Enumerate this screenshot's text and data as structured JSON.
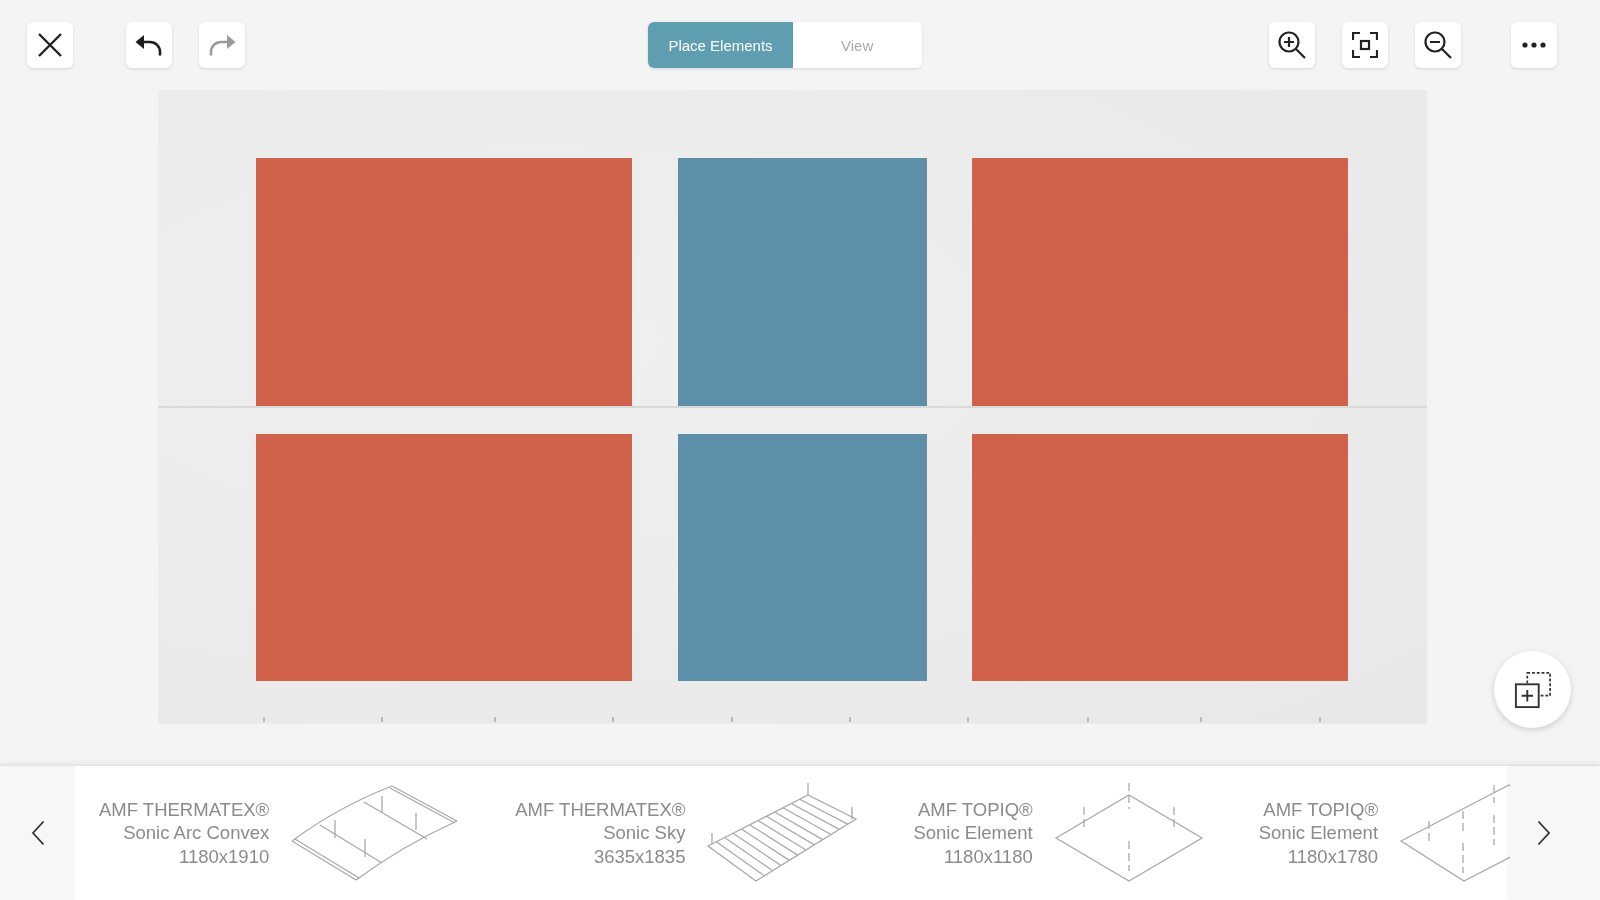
{
  "toolbar": {
    "history": [
      {
        "kind": "undo",
        "disabled": false
      },
      {
        "kind": "redo",
        "disabled": true
      }
    ],
    "mode_tabs": [
      {
        "label": "Place Elements",
        "selected": true
      },
      {
        "label": "View",
        "selected": false
      }
    ]
  },
  "canvas": {
    "panels": [
      {
        "color": "#d0624b"
      },
      {
        "color": "#5e8fa8"
      },
      {
        "color": "#d0624b"
      },
      {
        "color": "#d0624b"
      },
      {
        "color": "#5e8fa8"
      },
      {
        "color": "#d0624b"
      }
    ]
  },
  "product_strip": {
    "items": [
      {
        "kind": "arc",
        "brand": "AMF THERMATEX®",
        "name": "Sonic Arc Convex",
        "size": "1180x1910"
      },
      {
        "kind": "slats",
        "brand": "AMF THERMATEX®",
        "name": "Sonic Sky",
        "size": "3635x1835"
      },
      {
        "kind": "square",
        "brand": "AMF TOPIQ®",
        "name": "Sonic Element",
        "size": "1180x1180"
      },
      {
        "kind": "rect",
        "brand": "AMF TOPIQ®",
        "name": "Sonic Element",
        "size": "1180x1780"
      }
    ]
  }
}
